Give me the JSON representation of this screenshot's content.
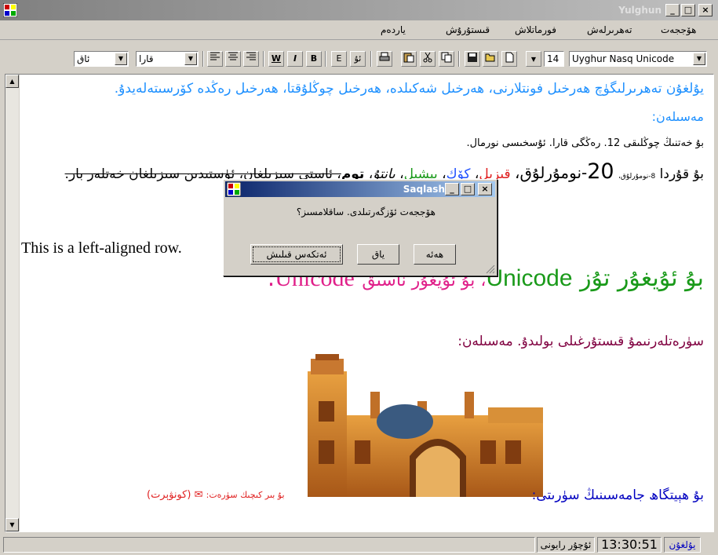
{
  "window": {
    "title": "Yulghun",
    "controls": [
      "_",
      "□",
      "×"
    ]
  },
  "menu": [
    "ھۆججەت",
    "تەھرىرلەش",
    "فورماتلاش",
    "قىستۇرۇش",
    "ياردەم"
  ],
  "toolbar": {
    "style_combo": "ئاق",
    "color_combo": "قارا",
    "font_size": "14",
    "font_name": "Uyghur Nasq Unicode",
    "buttons": [
      "W",
      "I",
      "B",
      "E",
      "ئۇ"
    ]
  },
  "document": {
    "line1": "يۇلغۇن تەھرىرلىگۈچ ھەرخىل فونتلارنى، ھەرخىل شەكىلدە، ھەرخىل چوڭلۇقتا، ھەرخىل رەڭدە كۆرسىتەلەيدۇ.",
    "line2": "مەسىلەن:",
    "line3": "بۇ خەتنىڭ چوڭلىقى 12. رەڭگى قارا. ئۇسخىسى نورمال.",
    "line4_parts": {
      "prefix": "بۇ قۇردا",
      "small": "8-نومۇرلۇق،",
      "big": "20",
      "big_suffix": "-نومۇرلۇق،",
      "red": "قىزىل",
      "blue": "كۆك",
      "green": "يېشىل",
      "italic": "يانتۇ",
      "bold": "توم",
      "rest": "، ئاستى سىزىلغان، ئۈستىدىن سىزىلغان خەتلەر بار."
    },
    "left_row": "This is a left-aligned row.",
    "line6_parts": {
      "green": "بۇ ئۇيغۇر تۇز",
      "unicode": "Unicode",
      "magenta": "، بۇ ئۇيغۇر ناسىق",
      "unicode2": "Unicode",
      "dot": "."
    },
    "line7": "سۈرەتلەرنىمۇ قىستۇرغىلى بولىدۇ. مەسىلەن:",
    "caption_blue": "بۇ ھېيتگاھ جامەسىنىڭ سۈرىتى:",
    "caption_red_small": "بۇ بىر كىچىك سۈرەت:",
    "caption_red": "(كونۋېرت)"
  },
  "status": {
    "panel1": "يۇلغۇن",
    "time": "13:30:51",
    "mode": "ئۇچۇر رايونى"
  },
  "dialog": {
    "title": "Saqlash",
    "message": "ھۆججەت ئۆزگەرتىلدى. ساقلامسىز؟",
    "buttons": {
      "yes": "ھەئە",
      "no": "ياق",
      "cancel": "ئەتكەس قىلىش"
    }
  },
  "colors": {
    "blue": "#1e90ff",
    "red": "#e02020",
    "green": "#1a9a1a",
    "magenta": "#e0208a",
    "maroon": "#800040"
  }
}
